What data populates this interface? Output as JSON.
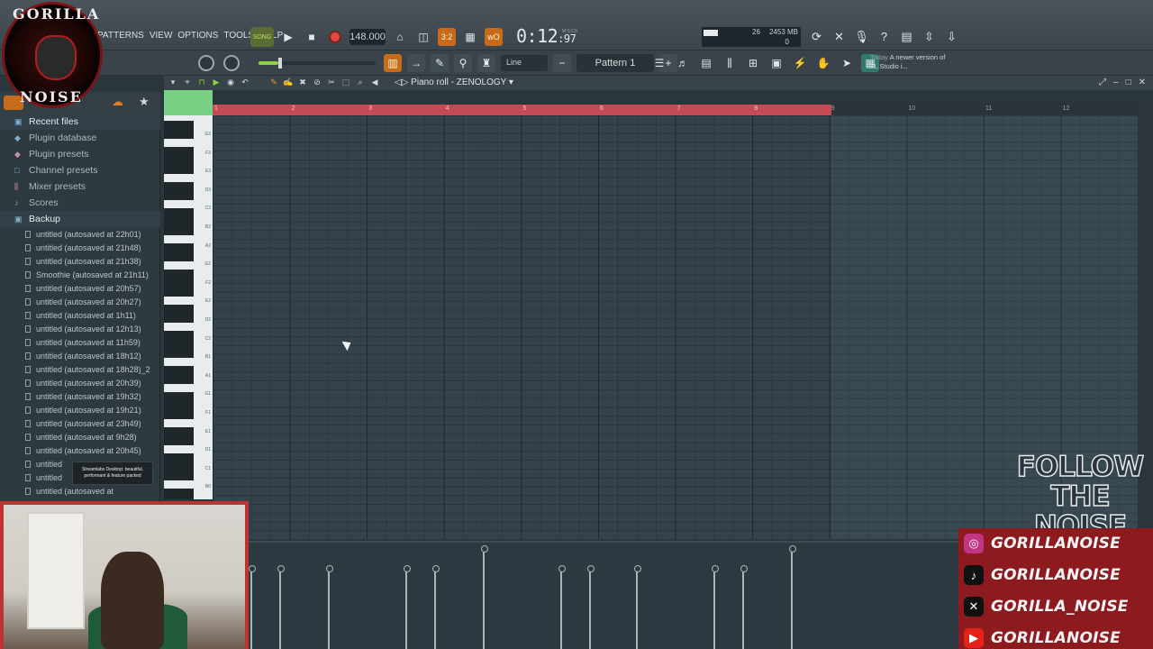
{
  "menu": [
    "PATTERNS",
    "VIEW",
    "OPTIONS",
    "TOOLS",
    "HELP"
  ],
  "transport": {
    "mode_label": "SONG",
    "tempo": "148.000",
    "time_main": "0:12",
    "time_sub": "97",
    "time_label": "M:S:CS"
  },
  "cpu": {
    "memory": "2453 MB",
    "voices": "26",
    "polyphony": "0"
  },
  "toolbar": {
    "snap_mode": "Line",
    "pattern": "Pattern 1"
  },
  "news": {
    "label": "Today",
    "text": "A newer version of FL Studio i..."
  },
  "piano_roll": {
    "title": "Piano roll - ZENOLOGY",
    "bar_numbers": [
      "1",
      "2",
      "3",
      "4",
      "5",
      "6",
      "7",
      "8",
      "9",
      "10",
      "11",
      "12"
    ]
  },
  "browser": {
    "categories": [
      {
        "label": "Recent files",
        "icon": "folder-icon"
      },
      {
        "label": "Plugin database",
        "icon": "plug-icon"
      },
      {
        "label": "Plugin presets",
        "icon": "plug-icon"
      },
      {
        "label": "Channel presets",
        "icon": "channel-icon"
      },
      {
        "label": "Mixer presets",
        "icon": "mixer-icon"
      },
      {
        "label": "Scores",
        "icon": "note-icon"
      },
      {
        "label": "Backup",
        "icon": "folder-icon"
      }
    ],
    "files": [
      "untitled (autosaved at 22h01)",
      "untitled (autosaved at 21h48)",
      "untitled (autosaved at 21h38)",
      "Smoothie (autosaved at 21h11)",
      "untitled (autosaved at 20h57)",
      "untitled (autosaved at 20h27)",
      "untitled (autosaved at 1h11)",
      "untitled (autosaved at 12h13)",
      "untitled (autosaved at 11h59)",
      "untitled (autosaved at 18h12)",
      "untitled (autosaved at 18h28)_2",
      "untitled (autosaved at 20h39)",
      "untitled (autosaved at 19h32)",
      "untitled (autosaved at 19h21)",
      "untitled (autosaved at 23h49)",
      "untitled (autosaved at 9h28)",
      "untitled (autosaved at 20h45)",
      "untitled",
      "untitled",
      "untitled (autosaved at"
    ],
    "tooltip": "Streamlabs Desktop: beautiful, performant & feature packed"
  },
  "keyboard_labels": [
    "G3",
    "F3",
    "E3",
    "D3",
    "C3",
    "B2",
    "A2",
    "G2",
    "F2",
    "E2",
    "D2",
    "C2",
    "B1",
    "A1",
    "G1",
    "F1",
    "E1",
    "D1",
    "C1",
    "B0"
  ],
  "overlay": {
    "logo_top": "GORILLA",
    "logo_bottom": "NOISE",
    "follow_line1": "FOLLOW",
    "follow_line2": "THE NOISE",
    "socials": [
      {
        "icon": "instagram-icon",
        "handle": "GORILLANOISE",
        "color": "#c13584"
      },
      {
        "icon": "tiktok-icon",
        "handle": "GORILLANOISE",
        "color": "#111111"
      },
      {
        "icon": "x-icon",
        "handle": "GORILLA_NOISE",
        "color": "#111111"
      },
      {
        "icon": "youtube-icon",
        "handle": "GORILLANOISE",
        "color": "#e62117"
      }
    ]
  },
  "colors": {
    "accent_orange": "#c56b1b",
    "loop_red": "#c44a55",
    "song_green": "#b7e05d"
  }
}
